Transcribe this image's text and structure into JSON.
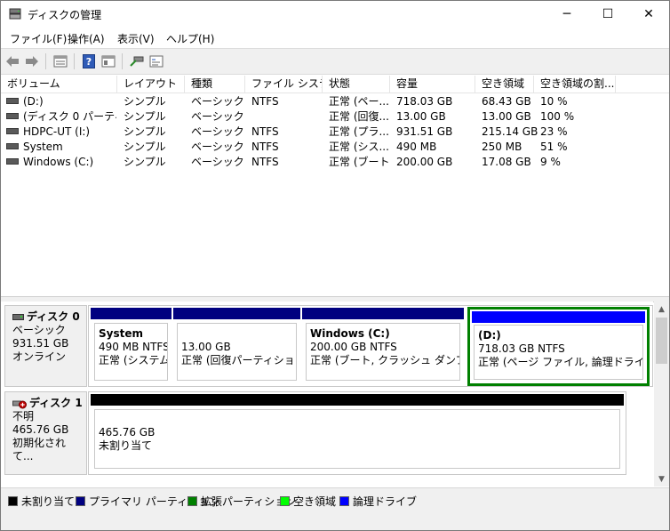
{
  "window": {
    "title": "ディスクの管理",
    "minimize": "─",
    "maximize": "☐",
    "close": "✕"
  },
  "menu": [
    {
      "label": "ファイル(F)"
    },
    {
      "label": "操作(A)"
    },
    {
      "label": "表示(V)"
    },
    {
      "label": "ヘルプ(H)"
    }
  ],
  "toolbar": {
    "icons": [
      "back-arrow-icon",
      "forward-arrow-icon",
      "properties-list-icon",
      "help-icon",
      "view-pane-icon",
      "disk-connect-icon",
      "console-icon"
    ]
  },
  "volume_table": {
    "headers": [
      "ボリューム",
      "レイアウト",
      "種類",
      "ファイル システム",
      "状態",
      "容量",
      "空き領域",
      "空き領域の割..."
    ],
    "rows": [
      [
        "(D:)",
        "シンプル",
        "ベーシック",
        "NTFS",
        "正常 (ペー...",
        "718.03 GB",
        "68.43 GB",
        "10 %"
      ],
      [
        "(ディスク 0 パーティシ...",
        "シンプル",
        "ベーシック",
        "",
        "正常 (回復...",
        "13.00 GB",
        "13.00 GB",
        "100 %"
      ],
      [
        "HDPC-UT (I:)",
        "シンプル",
        "ベーシック",
        "NTFS",
        "正常 (プラ...",
        "931.51 GB",
        "215.14 GB",
        "23 %"
      ],
      [
        "System",
        "シンプル",
        "ベーシック",
        "NTFS",
        "正常 (シス...",
        "490 MB",
        "250 MB",
        "51 %"
      ],
      [
        "Windows (C:)",
        "シンプル",
        "ベーシック",
        "NTFS",
        "正常 (ブート...",
        "200.00 GB",
        "17.08 GB",
        "9 %"
      ]
    ]
  },
  "disks": [
    {
      "name": "ディスク 0",
      "type": "ベーシック",
      "size": "931.51 GB",
      "status": "オンライン",
      "partitions": [
        {
          "title": "System",
          "line1": "490 MB NTFS",
          "line2": "正常 (システム, ア"
        },
        {
          "title": "",
          "line1": "13.00 GB",
          "line2": "正常 (回復パーティション)"
        },
        {
          "title": "Windows (C:)",
          "line1": "200.00 GB NTFS",
          "line2": "正常 (ブート, クラッシュ ダンプ, プライ"
        },
        {
          "title": "(D:)",
          "line1": "718.03 GB NTFS",
          "line2": "正常 (ページ ファイル, 論理ドライブ)"
        }
      ]
    },
    {
      "name": "ディスク 1",
      "type": "不明",
      "size": "465.76 GB",
      "status": "初期化されて...",
      "partitions": [
        {
          "title": "",
          "line1": "465.76 GB",
          "line2": "未割り当て"
        }
      ]
    }
  ],
  "legend": [
    {
      "label": "未割り当て",
      "color": "#000000"
    },
    {
      "label": "プライマリ パーティション",
      "color": "#000080"
    },
    {
      "label": "拡張パーティション",
      "color": "#008000"
    },
    {
      "label": "空き領域",
      "color": "#00ff00"
    },
    {
      "label": "論理ドライブ",
      "color": "#0000ff"
    }
  ],
  "colors": {
    "primary": "#000080",
    "logical": "#0000ff",
    "unallocated": "#000000",
    "extended": "#008000"
  }
}
